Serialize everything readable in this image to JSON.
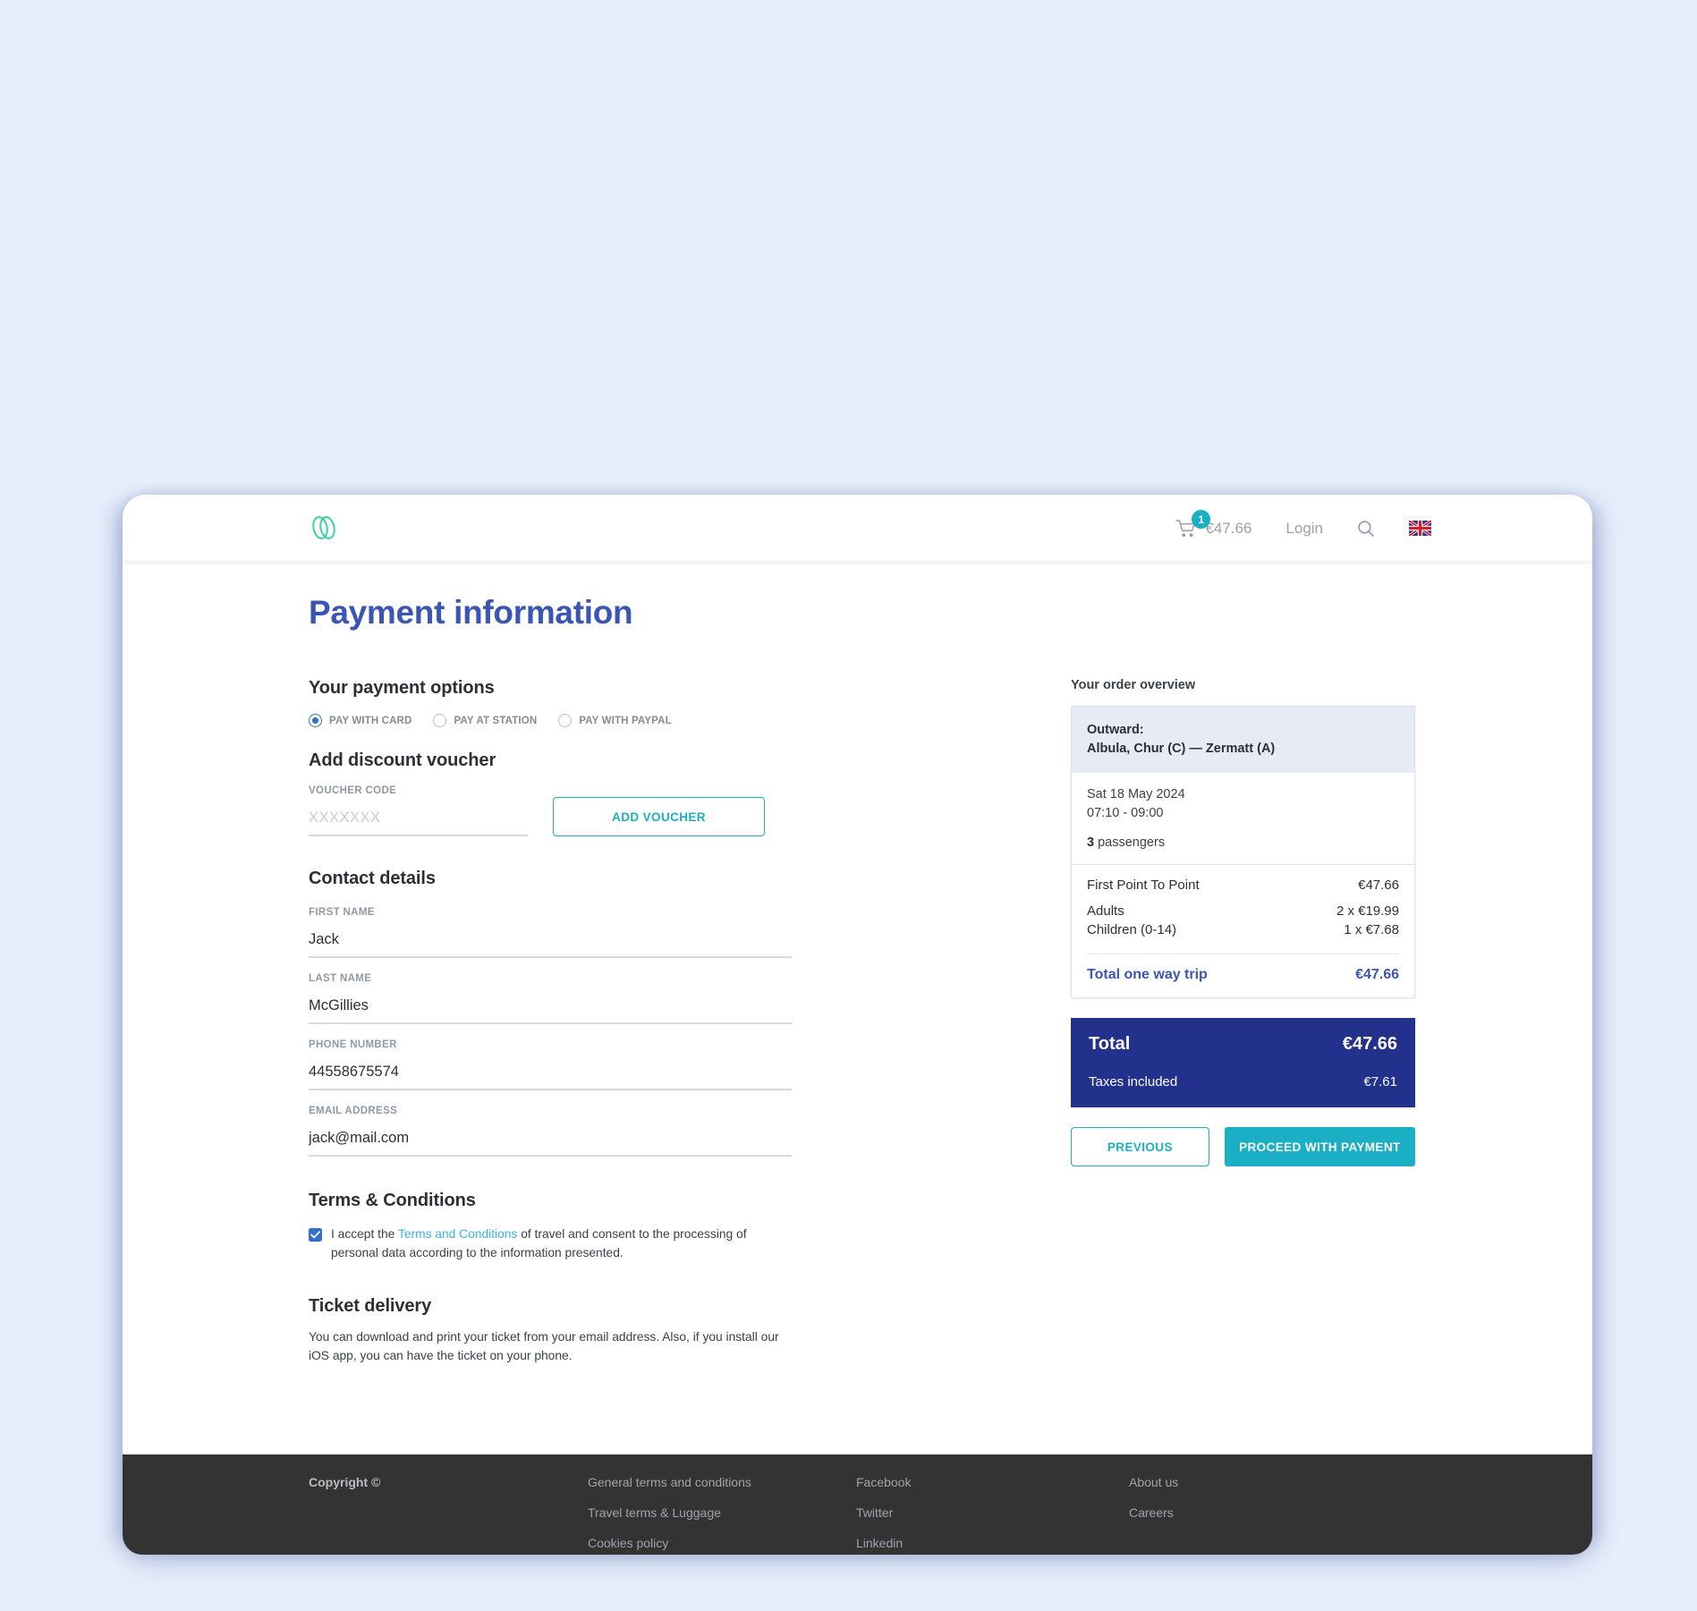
{
  "header": {
    "logo_icon": "double-ellipse-logo",
    "cart_icon": "shopping-cart-icon",
    "cart_badge": "1",
    "cart_price": "€47.66",
    "login_label": "Login",
    "search_icon": "search-icon",
    "flag_icon": "uk-flag-icon"
  },
  "page": {
    "title": "Payment information"
  },
  "payment_options": {
    "heading": "Your payment options",
    "options": [
      {
        "label": "PAY WITH CARD",
        "selected": true
      },
      {
        "label": "PAY AT STATION",
        "selected": false
      },
      {
        "label": "PAY WITH PAYPAL",
        "selected": false
      }
    ]
  },
  "voucher": {
    "heading": "Add discount voucher",
    "code_label": "VOUCHER CODE",
    "code_value": "",
    "code_placeholder": "XXXXXXX",
    "add_button": "ADD VOUCHER"
  },
  "contact": {
    "heading": "Contact details",
    "fields": [
      {
        "label": "FIRST NAME",
        "value": "Jack"
      },
      {
        "label": "LAST NAME",
        "value": "McGillies"
      },
      {
        "label": "PHONE NUMBER",
        "value": "44558675574"
      },
      {
        "label": "EMAIL ADDRESS",
        "value": "jack@mail.com"
      }
    ]
  },
  "terms": {
    "heading": "Terms & Conditions",
    "checked": true,
    "text_before": "I accept the ",
    "link_text": "Terms and Conditions",
    "text_after": " of travel and consent to the processing of personal data according to the information presented."
  },
  "ticket_delivery": {
    "heading": "Ticket delivery",
    "body": "You can download and print your ticket from your email address. Also, if you install our iOS app, you can have the ticket on your phone."
  },
  "order": {
    "title": "Your order overview",
    "direction_label": "Outward:",
    "route": "Albula, Chur (C) — Zermatt (A)",
    "date": "Sat 18 May 2024",
    "time": "07:10 - 09:00",
    "passengers_count": "3",
    "passengers_word": "passengers",
    "lines": [
      {
        "label": "First Point To Point",
        "value": "€47.66"
      },
      {
        "label": "Adults",
        "value": "2 x €19.99"
      },
      {
        "label": "Children (0-14)",
        "value": "1 x €7.68"
      }
    ],
    "total_trip_label": "Total one way trip",
    "total_trip_value": "€47.66",
    "total_label": "Total",
    "total_value": "€47.66",
    "taxes_label": "Taxes included",
    "taxes_value": "€7.61",
    "previous_button": "PREVIOUS",
    "proceed_button": "PROCEED WITH PAYMENT"
  },
  "footer": {
    "copyright": "Copyright ©",
    "col1": [
      "General terms and conditions",
      "Travel terms & Luggage",
      "Cookies policy"
    ],
    "col2": [
      "Facebook",
      "Twitter",
      "Linkedin"
    ],
    "col3": [
      "About us",
      "Careers"
    ]
  },
  "colors": {
    "accent_teal": "#1aafc4",
    "brand_blue": "#3b55b5",
    "total_navy": "#22318c",
    "logo_green": "#3ad29f",
    "page_bg": "#e6edfb"
  }
}
